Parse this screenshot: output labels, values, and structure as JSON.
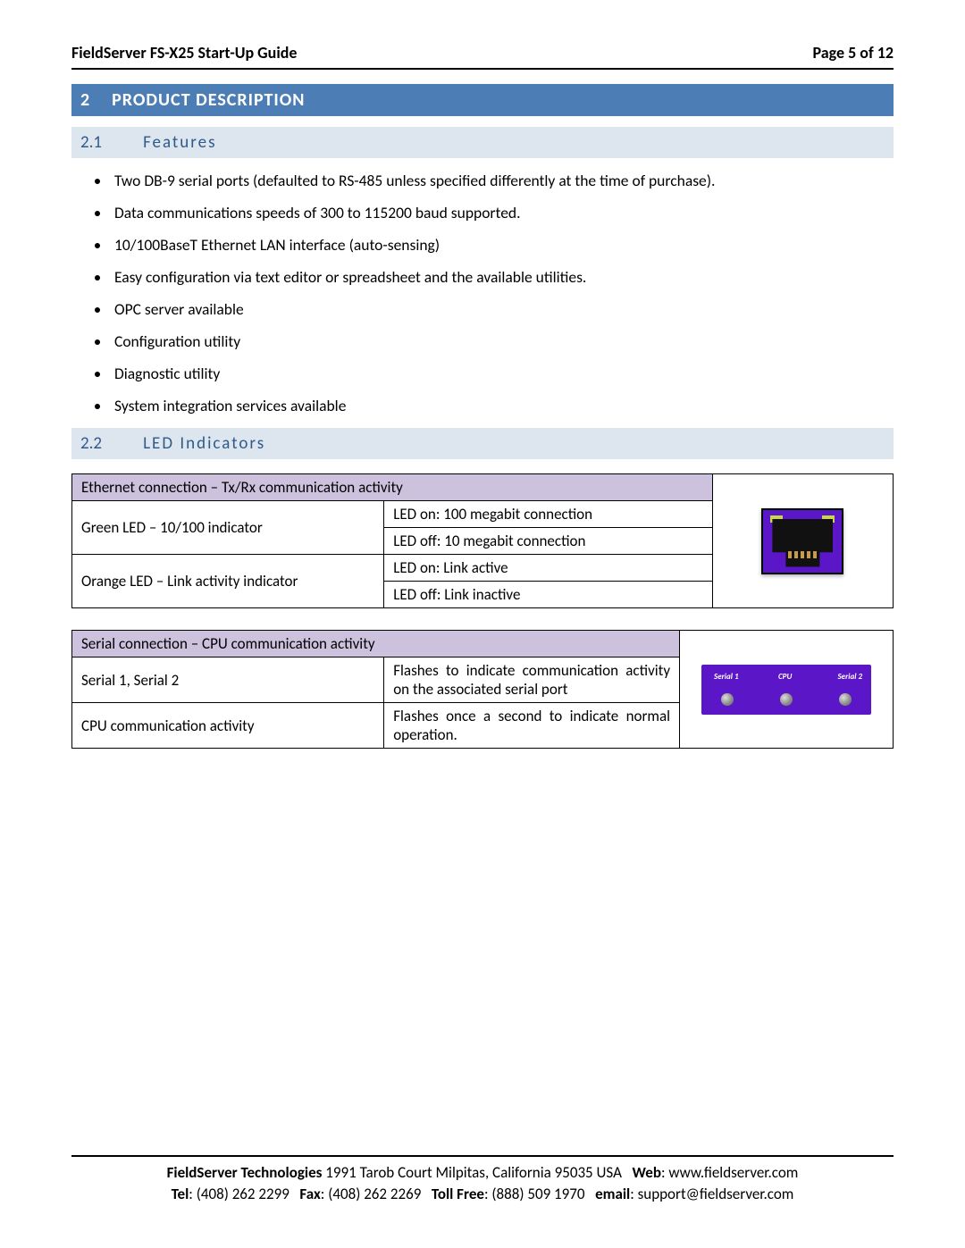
{
  "header": {
    "title": "FieldServer FS-X25 Start-Up Guide",
    "page": "Page 5 of 12"
  },
  "section": {
    "num": "2",
    "title": "PRODUCT DESCRIPTION"
  },
  "sub1": {
    "num": "2.1",
    "title": "Features"
  },
  "features": [
    "Two DB-9 serial ports (defaulted to RS-485 unless specified differently at the time of purchase).",
    "Data communications speeds of 300 to 115200 baud supported.",
    "10/100BaseT Ethernet LAN interface (auto-sensing)",
    "Easy configuration via text editor or spreadsheet and the available utilities.",
    "OPC server available",
    "Configuration utility",
    "Diagnostic utility",
    "System integration services available"
  ],
  "sub2": {
    "num": "2.2",
    "title": "LED Indicators"
  },
  "table1": {
    "header": "Ethernet connection – Tx/Rx communication activity",
    "r1c1": "Green LED – 10/100 indicator",
    "r1c2a": "LED on: 100 megabit connection",
    "r1c2b": "LED off: 10 megabit connection",
    "r2c1": "Orange LED – Link activity indicator",
    "r2c2a": "LED on: Link active",
    "r2c2b": "LED off: Link inactive"
  },
  "table2": {
    "header": "Serial connection – CPU communication activity",
    "r1c1": "Serial 1, Serial 2",
    "r1c2": "Flashes to indicate communication activity on the associated serial port",
    "r2c1": "CPU communication activity",
    "r2c2": "Flashes once a second to indicate normal operation.",
    "panel": {
      "s1": "Serial 1",
      "cpu": "CPU",
      "s2": "Serial 2"
    }
  },
  "footer": {
    "company": "FieldServer Technologies",
    "address": "1991 Tarob Court Milpitas, California 95035 USA",
    "web_lbl": "Web",
    "web": "www.fieldserver.com",
    "tel_lbl": "Tel",
    "tel": "(408) 262 2299",
    "fax_lbl": "Fax",
    "fax": "(408) 262 2269",
    "tollfree_lbl": "Toll Free",
    "tollfree": "(888) 509 1970",
    "email_lbl": "email",
    "email": "support@fieldserver.com"
  }
}
